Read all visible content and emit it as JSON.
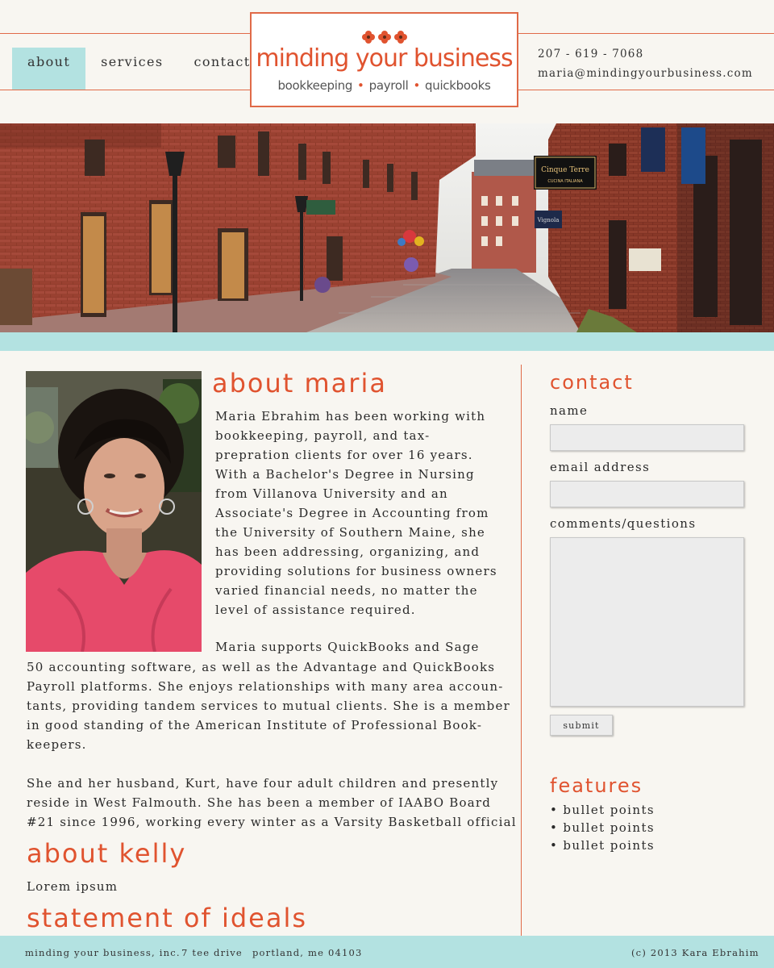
{
  "nav": {
    "items": [
      {
        "label": "about",
        "active": true
      },
      {
        "label": "services",
        "active": false
      },
      {
        "label": "contact",
        "active": false
      }
    ]
  },
  "logo": {
    "title": "minding your business",
    "tag_1": "bookkeeping",
    "tag_2": "payroll",
    "tag_3": "quickbooks"
  },
  "header_contact": {
    "phone": "207 - 619 - 7068",
    "email": "maria@mindingyourbusiness.com"
  },
  "about_maria": {
    "heading": "about maria",
    "p1_lines": [
      "Maria Ebrahim has been working with",
      "bookkeeping, payroll, and tax-",
      "prepration clients for over 16 years.",
      "With a Bachelor's Degree in Nursing",
      "from Villanova University and an",
      "Associate's Degree in Accounting from",
      "the University of Southern Maine, she",
      "has been addressing, organizing, and",
      "providing solutions for business owners",
      "varied financial needs, no matter the",
      "level of assistance required."
    ],
    "p2_first": "Maria supports QuickBooks and Sage",
    "p2_lines": [
      "50 accounting software, as well as the Advantage and QuickBooks",
      "Payroll platforms. She enjoys relationships with many area accoun-",
      "tants, providing tandem services to mutual clients. She is a member",
      "in good standing of the American Institute of Professional Book-",
      "keepers."
    ],
    "p3_lines": [
      "She and her husband, Kurt, have four adult children and presently",
      "reside in West Falmouth. She has been a member of IAABO Board",
      "#21 since 1996, working every winter as a Varsity Basketball official"
    ]
  },
  "about_kelly": {
    "heading": "about kelly",
    "text": "Lorem ipsum"
  },
  "statement": {
    "heading": "statement of ideals"
  },
  "contact_form": {
    "heading": "contact",
    "name_label": "name",
    "name_value": "",
    "email_label": "email address",
    "email_value": "",
    "comments_label": "comments/questions",
    "comments_value": "",
    "submit_label": "submit"
  },
  "features": {
    "heading": "features",
    "items": [
      "bullet points",
      "bullet points",
      "bullet points"
    ]
  },
  "footer": {
    "company": "minding your business, inc.",
    "street": "7 tee drive",
    "city": "portland, me 04103",
    "copyright": "(c) 2013 Kara Ebrahim"
  },
  "colors": {
    "accent": "#e0532f",
    "teal": "#b3e2e1",
    "background": "#f8f6f1"
  }
}
